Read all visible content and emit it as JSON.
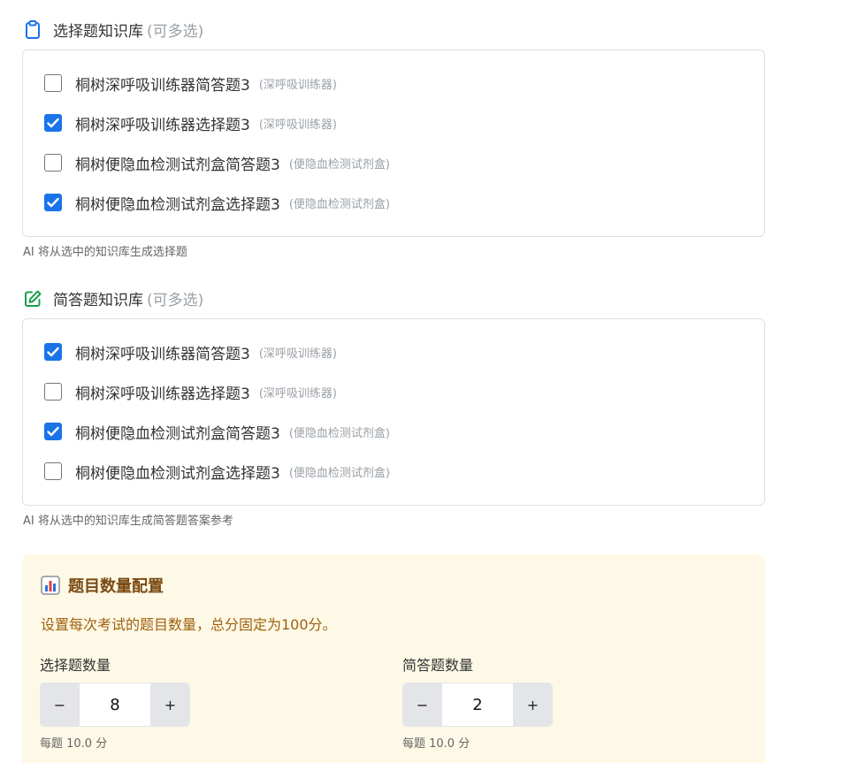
{
  "mc_section": {
    "title": "选择题知识库",
    "hint": "(可多选)",
    "icon": "clipboard-icon",
    "items": [
      {
        "label": "桐树深呼吸训练器简答题3",
        "tag": "(深呼吸训练器)",
        "checked": false
      },
      {
        "label": "桐树深呼吸训练器选择题3",
        "tag": "(深呼吸训练器)",
        "checked": true
      },
      {
        "label": "桐树便隐血检测试剂盒简答题3",
        "tag": "(便隐血检测试剂盒)",
        "checked": false
      },
      {
        "label": "桐树便隐血检测试剂盒选择题3",
        "tag": "(便隐血检测试剂盒)",
        "checked": true
      }
    ],
    "note": "AI 将从选中的知识库生成选择题"
  },
  "sa_section": {
    "title": "简答题知识库",
    "hint": "(可多选)",
    "icon": "edit-icon",
    "items": [
      {
        "label": "桐树深呼吸训练器简答题3",
        "tag": "(深呼吸训练器)",
        "checked": true
      },
      {
        "label": "桐树深呼吸训练器选择题3",
        "tag": "(深呼吸训练器)",
        "checked": false
      },
      {
        "label": "桐树便隐血检测试剂盒简答题3",
        "tag": "(便隐血检测试剂盒)",
        "checked": true
      },
      {
        "label": "桐树便隐血检测试剂盒选择题3",
        "tag": "(便隐血检测试剂盒)",
        "checked": false
      }
    ],
    "note": "AI 将从选中的知识库生成简答题答案参考"
  },
  "config": {
    "icon": "bar-chart-icon",
    "title": "题目数量配置",
    "desc": "设置每次考试的题目数量，总分固定为100分。",
    "mc": {
      "label": "选择题数量",
      "minus": "−",
      "value": "8",
      "plus": "+",
      "per_score": "每题 10.0 分"
    },
    "sa": {
      "label": "简答题数量",
      "minus": "−",
      "value": "2",
      "plus": "+",
      "per_score": "每题 10.0 分"
    }
  },
  "colors": {
    "checkbox_checked": "#1a73e8",
    "config_bg": "#fdf9e6",
    "config_title": "#7a4a11",
    "config_desc": "#a0600e"
  }
}
